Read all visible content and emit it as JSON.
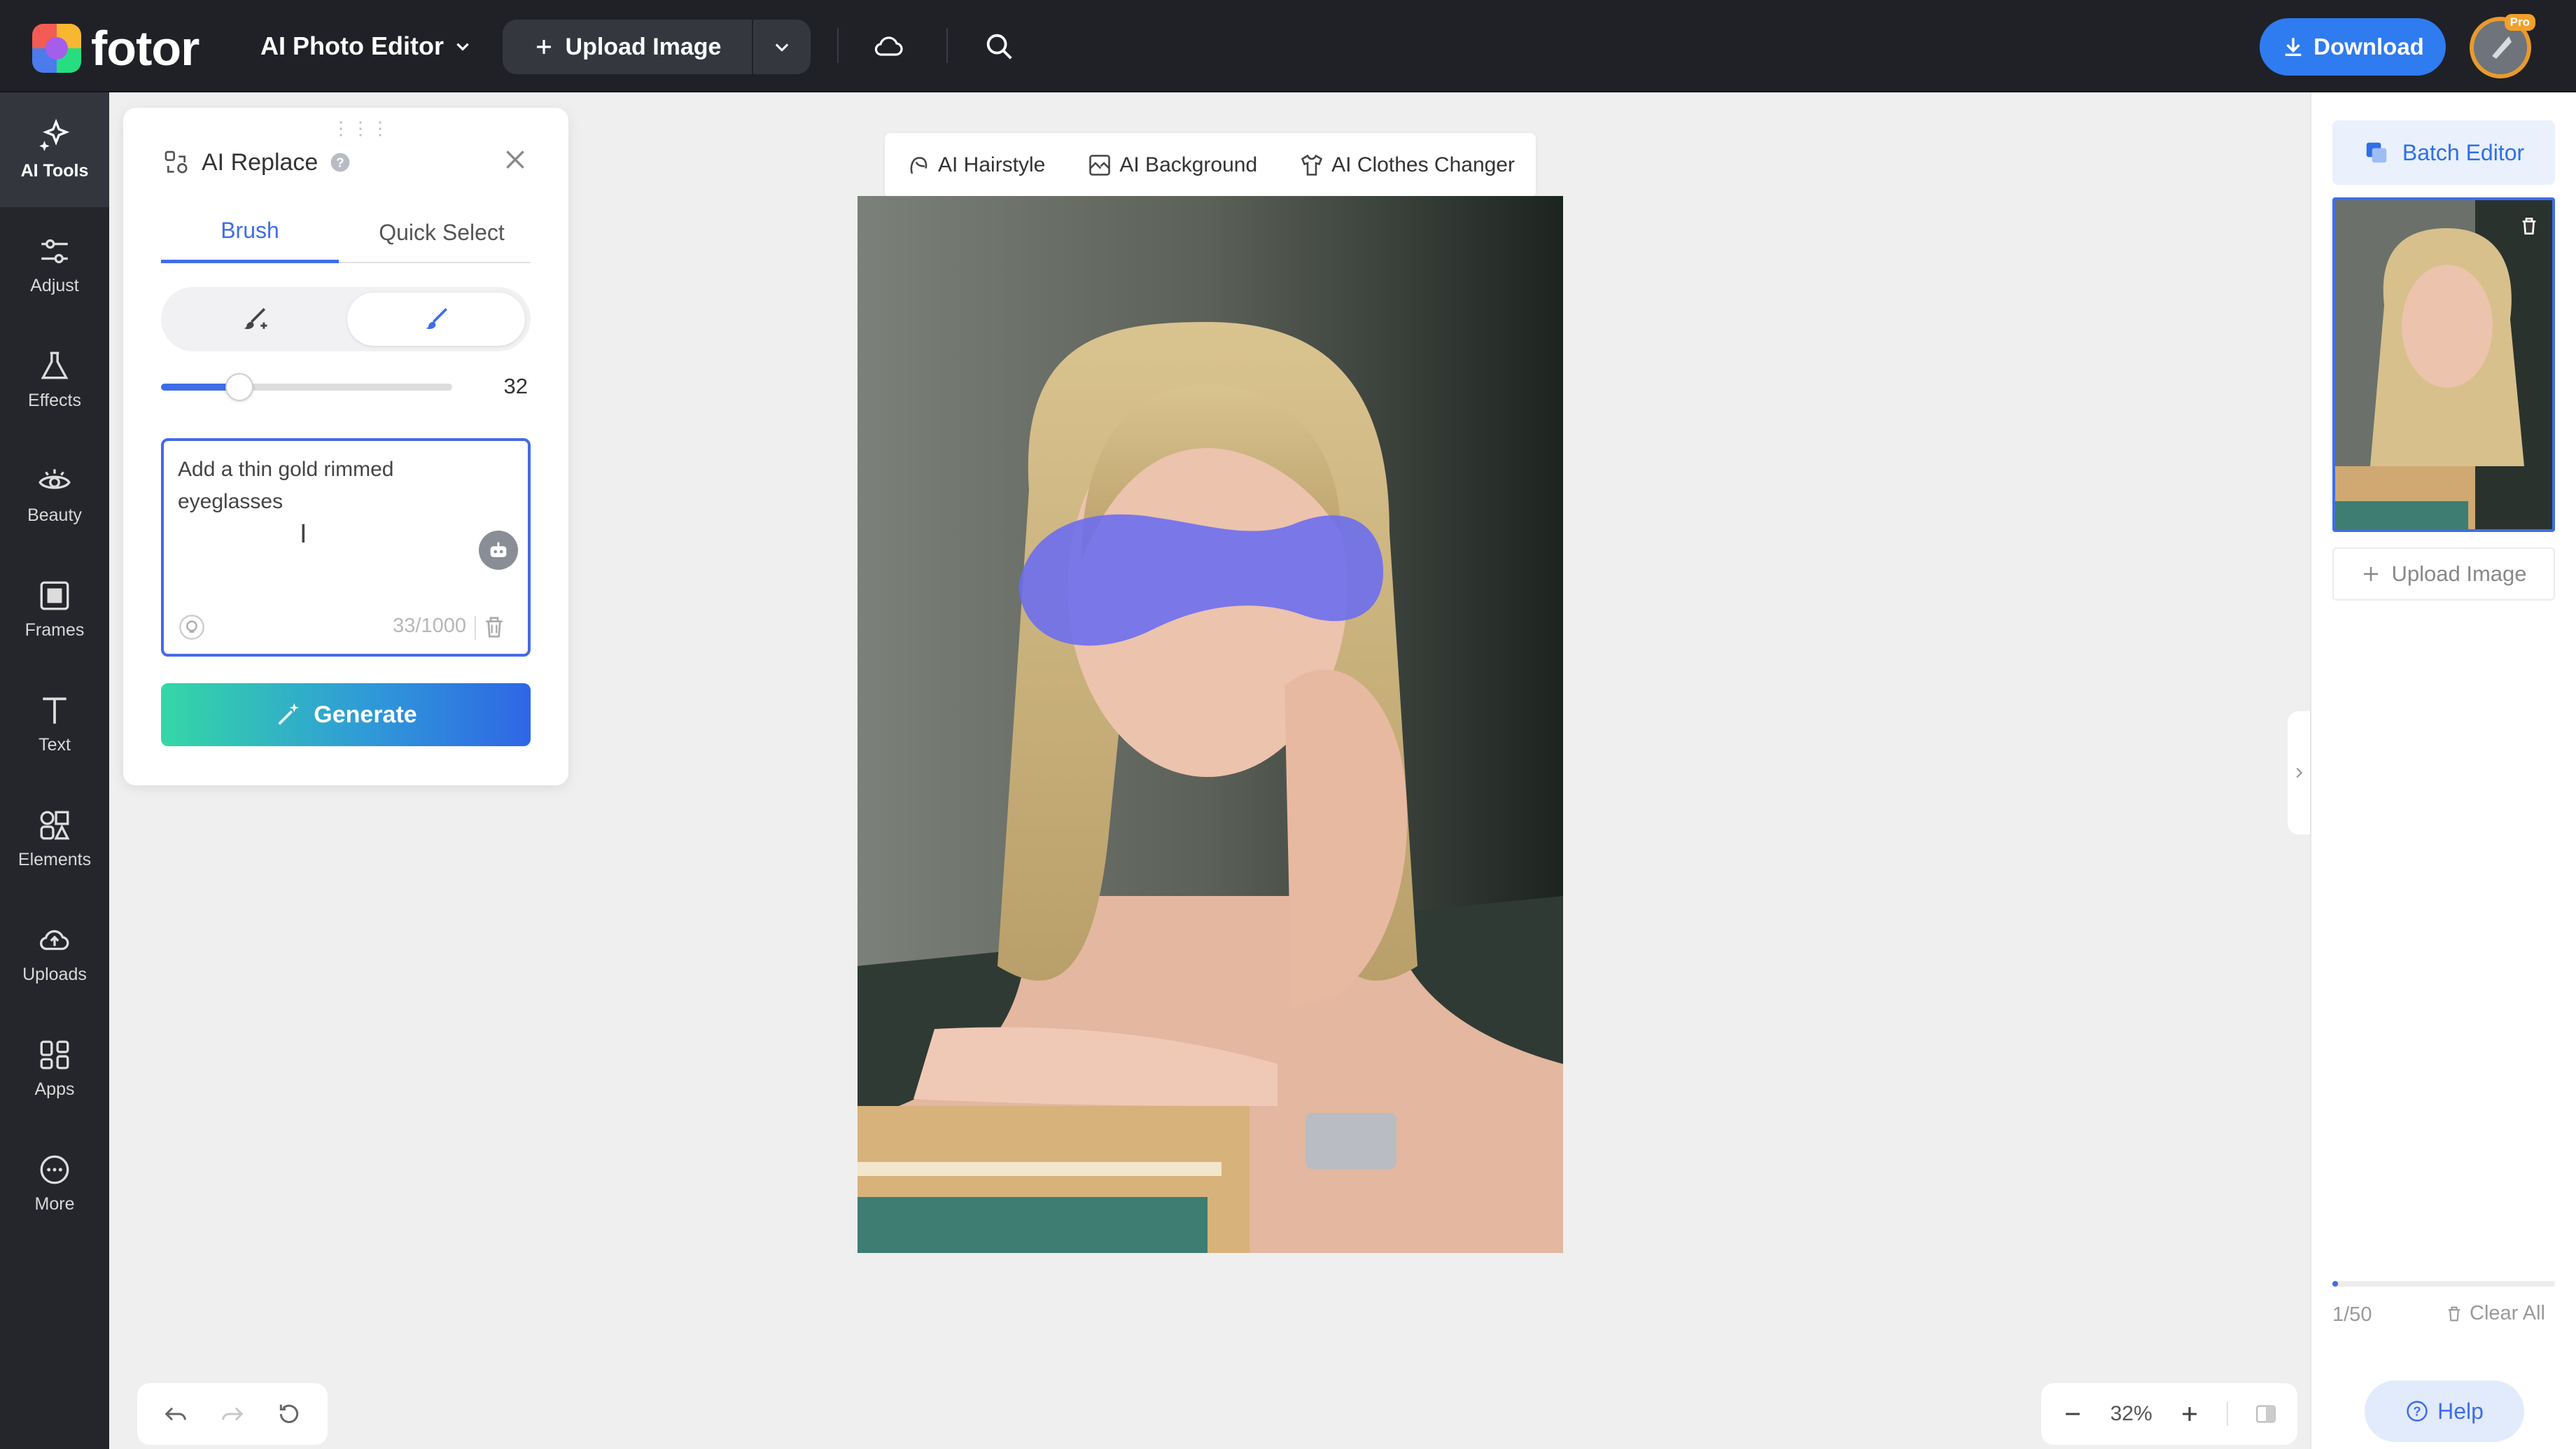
{
  "brand": {
    "name": "fotor"
  },
  "topbar": {
    "editor_menu": "AI Photo Editor",
    "upload_label": "Upload Image",
    "download_label": "Download",
    "pro_badge": "Pro"
  },
  "sidebar": {
    "items": [
      {
        "label": "AI Tools",
        "icon": "sparkles-icon",
        "active": true
      },
      {
        "label": "Adjust",
        "icon": "sliders-icon"
      },
      {
        "label": "Effects",
        "icon": "flask-icon"
      },
      {
        "label": "Beauty",
        "icon": "eye-icon"
      },
      {
        "label": "Frames",
        "icon": "frame-icon"
      },
      {
        "label": "Text",
        "icon": "text-icon"
      },
      {
        "label": "Elements",
        "icon": "shapes-icon"
      },
      {
        "label": "Uploads",
        "icon": "cloud-upload-icon"
      },
      {
        "label": "Apps",
        "icon": "apps-icon"
      },
      {
        "label": "More",
        "icon": "more-icon"
      }
    ]
  },
  "panel": {
    "title": "AI Replace",
    "tabs": [
      {
        "label": "Brush",
        "active": true
      },
      {
        "label": "Quick Select",
        "active": false
      }
    ],
    "brush_size": "32",
    "brush_size_fraction": 0.27,
    "prompt_text": "Add a thin gold rimmed eyeglasses",
    "char_count": "33/1000",
    "generate_label": "Generate"
  },
  "ai_toolbar": {
    "tools": [
      "AI Hairstyle",
      "AI Background",
      "AI Clothes Changer"
    ]
  },
  "right_panel": {
    "batch_label": "Batch Editor",
    "upload_label": "Upload Image",
    "count": "1/50",
    "clear_label": "Clear All",
    "help_label": "Help"
  },
  "zoom": {
    "value": "32%"
  },
  "colors": {
    "accent": "#3f6de8",
    "mask": "#6a6cf0",
    "topbar": "#1f2126"
  }
}
